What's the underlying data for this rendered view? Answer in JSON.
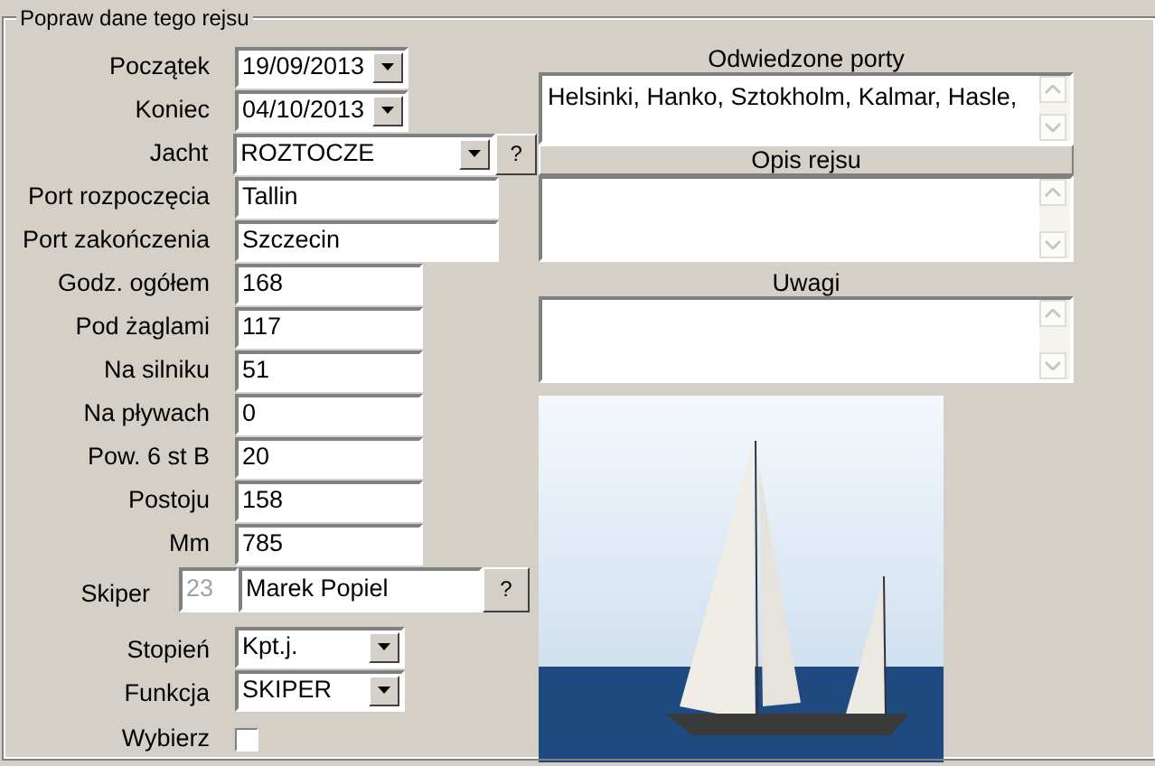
{
  "form": {
    "title": "Popraw dane tego rejsu"
  },
  "fields": [
    {
      "kind": "date",
      "label": "Początek",
      "value": "19/09/2013"
    },
    {
      "kind": "date",
      "label": "Koniec",
      "value": "04/10/2013"
    },
    {
      "kind": "select-lookup",
      "label": "Jacht",
      "value": "ROZTOCZE",
      "button": "?"
    },
    {
      "kind": "wide",
      "label": "Port rozpoczęcia",
      "value": "Tallin"
    },
    {
      "kind": "wide",
      "label": "Port zakończenia",
      "value": "Szczecin"
    },
    {
      "kind": "number",
      "label": "Godz. ogółem",
      "value": "168"
    },
    {
      "kind": "number",
      "label": "Pod żaglami",
      "value": "117"
    },
    {
      "kind": "number",
      "label": "Na silniku",
      "value": "51"
    },
    {
      "kind": "number",
      "label": "Na pływach",
      "value": "0"
    },
    {
      "kind": "number",
      "label": "Pow. 6 st B",
      "value": "20"
    },
    {
      "kind": "number",
      "label": "Postoju",
      "value": "158"
    },
    {
      "kind": "number",
      "label": "Mm",
      "value": "785"
    }
  ],
  "skipper": {
    "label": "Skiper",
    "id": "23",
    "name": "Marek Popiel",
    "button": "?"
  },
  "selects": [
    {
      "label": "Stopień",
      "value": "Kpt.j."
    },
    {
      "label": "Funkcja",
      "value": "SKIPER"
    }
  ],
  "choose": {
    "label": "Wybierz",
    "checked": false
  },
  "notes": [
    {
      "kind": "plain",
      "label": "Odwiedzone porty",
      "value": "Helsinki, Hanko, Sztokholm, Kalmar, Hasle,"
    },
    {
      "kind": "bar",
      "label": "Opis rejsu"
    },
    {
      "kind": "plain",
      "label": "Uwagi"
    }
  ]
}
